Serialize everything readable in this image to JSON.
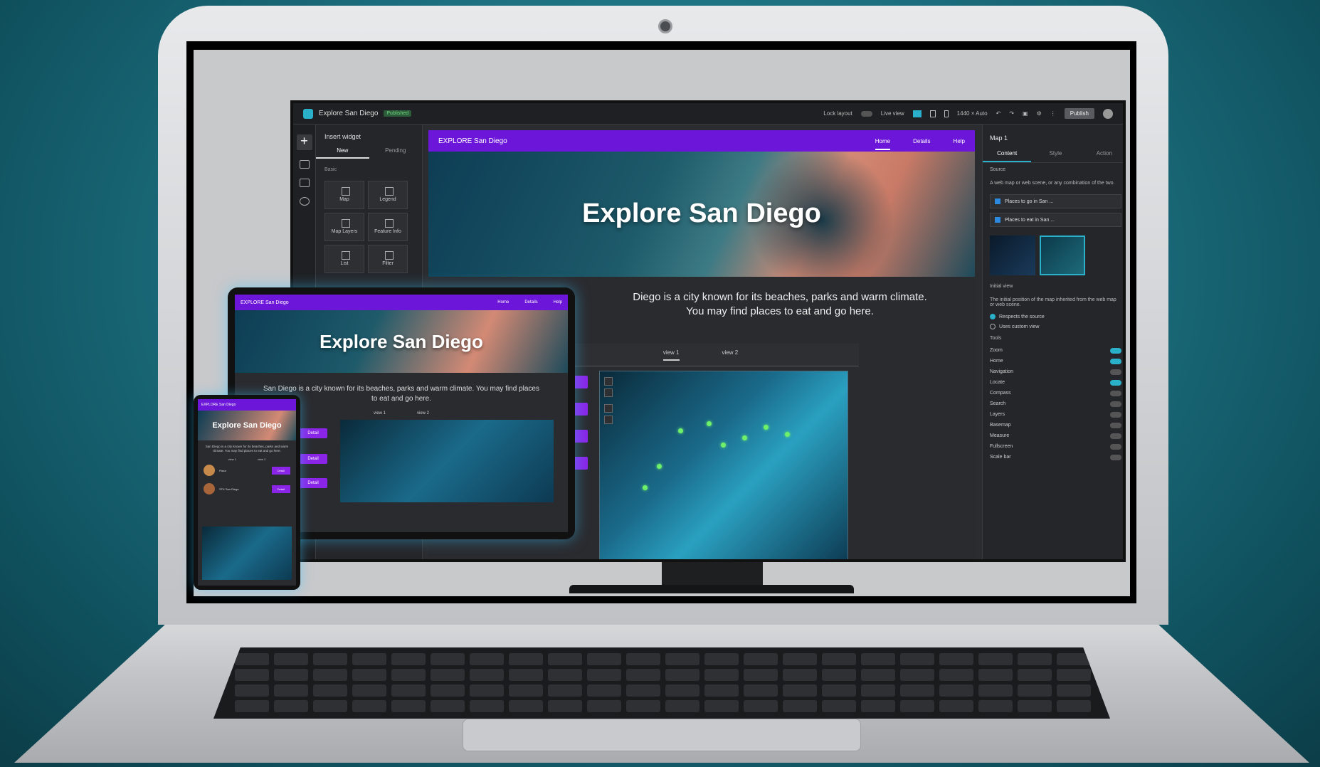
{
  "builder": {
    "app_title": "Explore San Diego",
    "status_badge": "Published",
    "lock_layout_label": "Lock layout",
    "live_view_label": "Live view",
    "size_label": "1440 × Auto",
    "publish_label": "Publish"
  },
  "widget_panel": {
    "title": "Insert widget",
    "tabs": [
      "New",
      "Pending"
    ],
    "section": "Basic",
    "widgets": [
      "Map",
      "Legend",
      "Map Layers",
      "Feature Info",
      "List",
      "Filter"
    ]
  },
  "site": {
    "brand": "EXPLORE San Diego",
    "nav": [
      "Home",
      "Details",
      "Help"
    ],
    "hero_title": "Explore San Diego",
    "intro_line1": "Diego is a city known for its beaches, parks and warm climate.",
    "intro_line2": "You may find places to eat and go here.",
    "view_tabs": [
      "view 1",
      "view 2"
    ],
    "detail_label": "Detail"
  },
  "settings": {
    "title": "Map 1",
    "tabs": [
      "Content",
      "Style",
      "Action"
    ],
    "source_heading": "Source",
    "source_desc": "A web map or web scene, or any combination of the two.",
    "sources": [
      "Places to go in San ...",
      "Places to eat in San ..."
    ],
    "initial_view_heading": "Initial view",
    "initial_view_desc": "The initial position of the map inherited from the web map or web scene.",
    "initial_options": [
      "Respects the source",
      "Uses custom view"
    ],
    "tools_heading": "Tools",
    "tools": [
      "Zoom",
      "Home",
      "Navigation",
      "Locate",
      "Compass",
      "Search",
      "Layers",
      "Basemap",
      "Measure",
      "Fullscreen",
      "Scale bar"
    ],
    "tools_on": [
      true,
      true,
      false,
      true,
      false,
      false,
      false,
      false,
      false,
      false,
      false
    ]
  },
  "tablet": {
    "brand": "EXPLORE San Diego",
    "nav": [
      "Home",
      "Details",
      "Help"
    ],
    "hero_title": "Explore San Diego",
    "intro": "San Diego is a city known for its beaches, parks and warm climate. You may find places to eat and go here.",
    "view_tabs": [
      "view 1",
      "view 2"
    ],
    "detail_label": "Detail"
  },
  "phone": {
    "brand": "EXPLORE San Diego",
    "hero_title": "Explore San Diego",
    "intro": "San Diego is a city known for its beaches, parks and warm climate. You may find places to eat and go here.",
    "view_tabs": [
      "view 1",
      "view 2"
    ],
    "rows": [
      "Pizza",
      "STK San Diego"
    ],
    "detail_label": "Detail"
  },
  "colors": {
    "brand_purple": "#6b16d8",
    "button_purple": "#8a25e8",
    "accent_teal": "#2bb0c9",
    "map_pin": "#6ff06a"
  }
}
